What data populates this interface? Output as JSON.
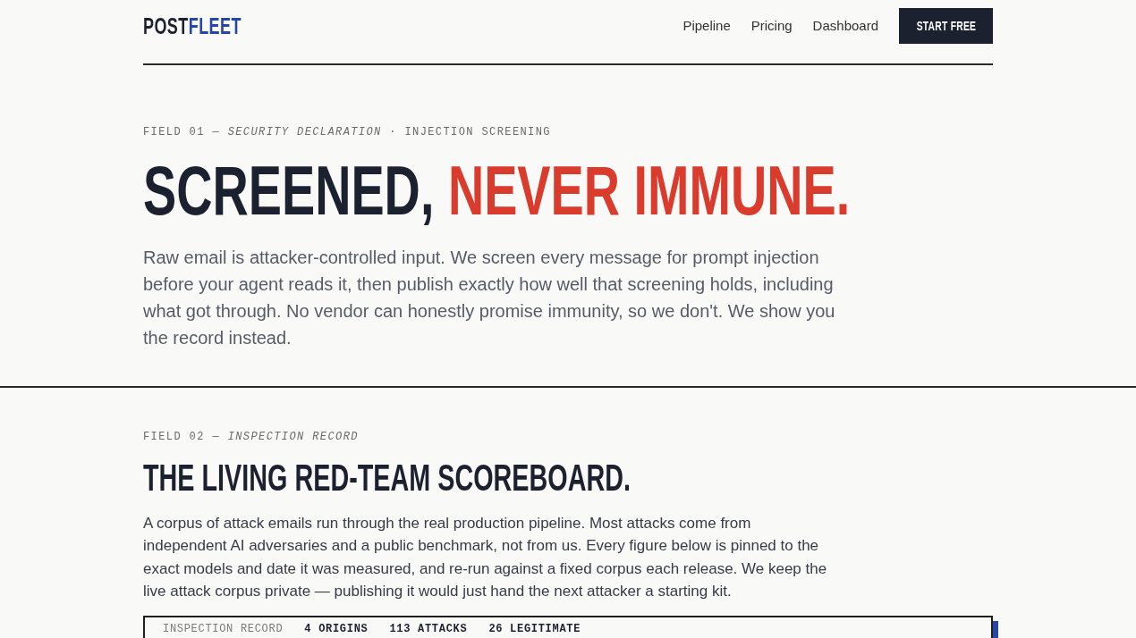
{
  "header": {
    "logo": [
      {
        "text": "POST",
        "accent": false
      },
      {
        "text": "FLEET",
        "accent": true
      }
    ],
    "nav": [
      "Pipeline",
      "Pricing",
      "Dashboard"
    ],
    "cta": "START FREE"
  },
  "sections": [
    {
      "kind": "hero",
      "eyebrow": "FIELD 01 — *SECURITY DECLARATION* · INJECTION SCREENING",
      "heading": [
        {
          "text": "SCREENED,",
          "accent": false
        },
        {
          "text": "NEVER IMMUNE.",
          "accent": true
        }
      ],
      "body": "Raw email is attacker-controlled input. We screen every message for prompt injection before your agent reads it, then publish exactly how well that screening holds, including what got through. No vendor can honestly promise immunity, so we don't. We show you the record instead."
    },
    {
      "kind": "section",
      "eyebrow": "FIELD 02 — *INSPECTION RECORD*",
      "heading": [
        {
          "text": "THE LIVING RED-TEAM SCOREBOARD.",
          "accent": false
        }
      ],
      "body": "A corpus of attack emails run through the real production pipeline. Most attacks come from independent AI adversaries and a public benchmark, not from us. Every figure below is pinned to the exact models and date it was measured, and re-run against a fixed corpus each release. We keep the live attack corpus private — publishing it would just hand the next attacker a starting kit.",
      "record": {
        "label": "INSPECTION RECORD",
        "stats": [
          "4 ORIGINS",
          "113 ATTACKS",
          "26 LEGITIMATE"
        ]
      }
    }
  ]
}
